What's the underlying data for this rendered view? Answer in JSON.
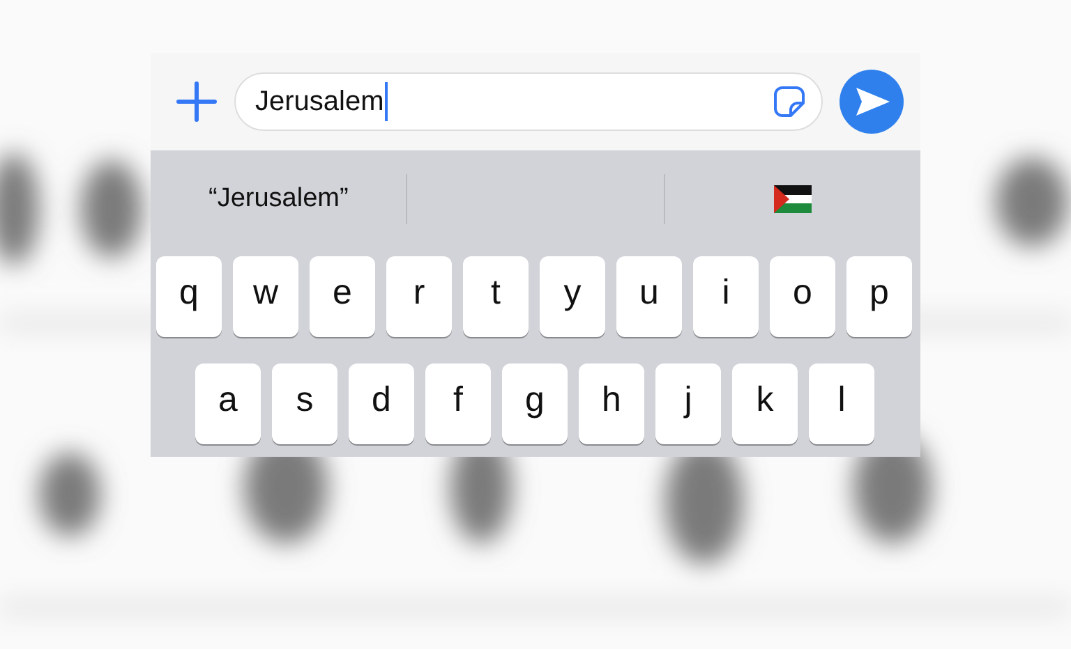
{
  "message_field": {
    "value": "Jerusalem"
  },
  "suggestions": [
    {
      "text": "“Jerusalem”"
    }
  ],
  "keyboard": {
    "rows": [
      [
        "q",
        "w",
        "e",
        "r",
        "t",
        "y",
        "u",
        "i",
        "o",
        "p"
      ],
      [
        "a",
        "s",
        "d",
        "f",
        "g",
        "h",
        "j",
        "k",
        "l"
      ]
    ]
  }
}
